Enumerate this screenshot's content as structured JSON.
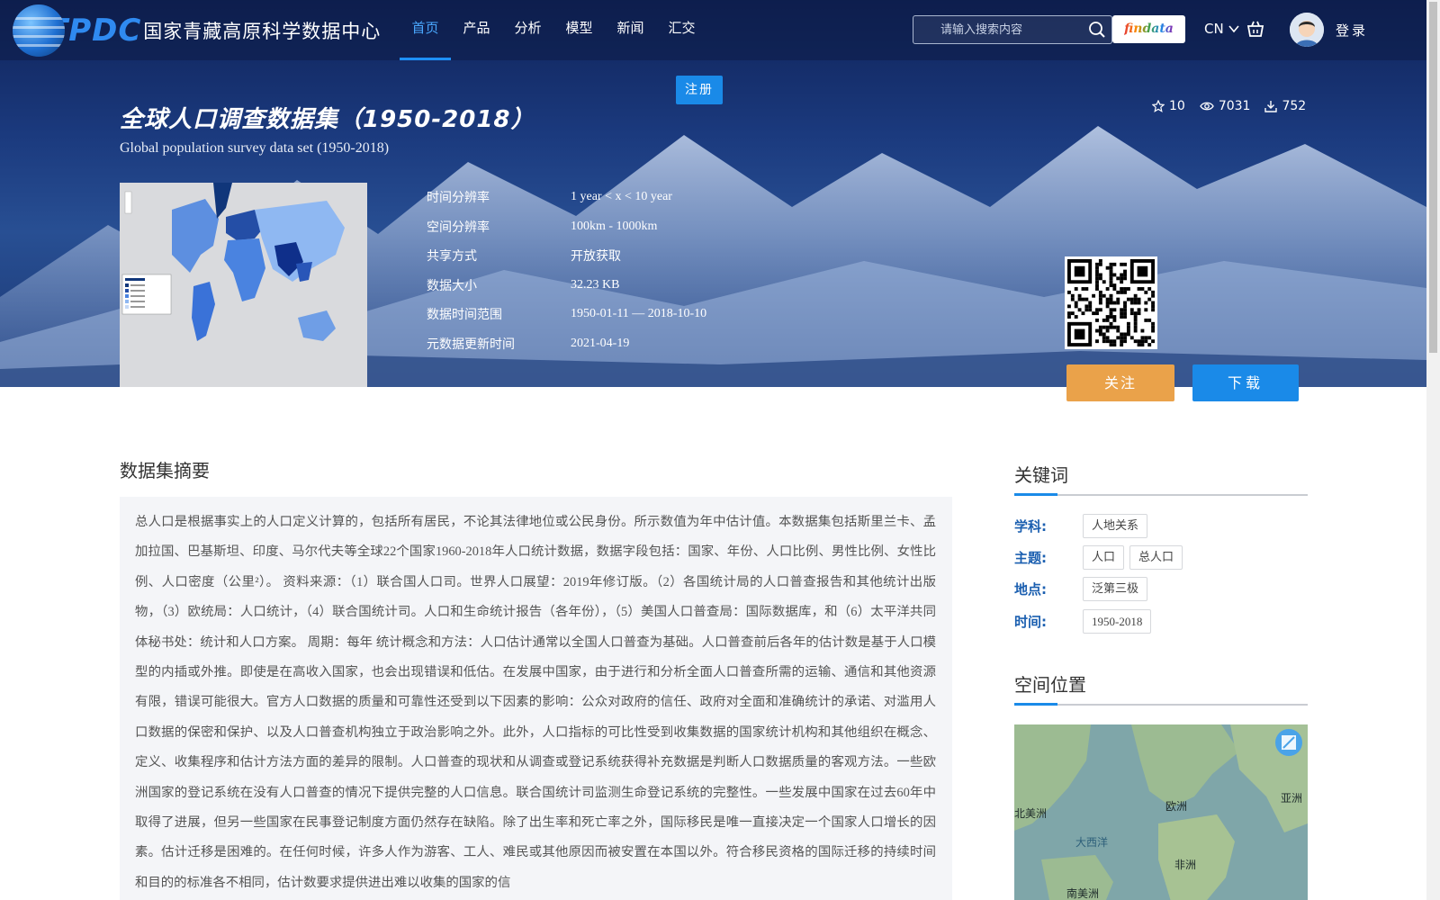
{
  "header": {
    "logo_mark": "TPDC",
    "logo_name": "国家青藏高原科学数据中心",
    "nav": [
      "首页",
      "产品",
      "分析",
      "模型",
      "新闻",
      "汇交"
    ],
    "active_nav": "首页",
    "search_placeholder": "请输入搜索内容",
    "findata_label": "findata",
    "lang": "CN",
    "login": "登录"
  },
  "register_label": "注册",
  "dataset": {
    "title_cn": "全球人口调查数据集（1950-2018）",
    "title_en": "Global population survey data set (1950-2018)",
    "stars": "10",
    "views": "7031",
    "downloads": "752",
    "meta": [
      {
        "key": "时间分辨率",
        "value": "1 year < x < 10 year"
      },
      {
        "key": "空间分辨率",
        "value": "100km - 1000km"
      },
      {
        "key": "共享方式",
        "value": "开放获取"
      },
      {
        "key": "数据大小",
        "value": "32.23 KB"
      },
      {
        "key": "数据时间范围",
        "value": "1950-01-11 — 2018-10-10"
      },
      {
        "key": "元数据更新时间",
        "value": "2021-04-19"
      }
    ],
    "follow_label": "关注",
    "download_label": "下载"
  },
  "abstract": {
    "title": "数据集摘要",
    "text": "总人口是根据事实上的人口定义计算的，包括所有居民，不论其法律地位或公民身份。所示数值为年中估计值。本数据集包括斯里兰卡、孟加拉国、巴基斯坦、印度、马尔代夫等全球22个国家1960-2018年人口统计数据，数据字段包括：国家、年份、人口比例、男性比例、女性比例、人口密度（公里²）。 资料来源：（1）联合国人口司。世界人口展望：2019年修订版。（2）各国统计局的人口普查报告和其他统计出版物，（3）欧统局：人口统计，（4）联合国统计司。人口和生命统计报告（各年份），（5）美国人口普查局：国际数据库，和（6）太平洋共同体秘书处：统计和人口方案。 周期：每年 统计概念和方法：人口估计通常以全国人口普查为基础。人口普查前后各年的估计数是基于人口模型的内插或外推。即使是在高收入国家，也会出现错误和低估。在发展中国家，由于进行和分析全面人口普查所需的运输、通信和其他资源有限，错误可能很大。官方人口数据的质量和可靠性还受到以下因素的影响：公众对政府的信任、政府对全面和准确统计的承诺、对滥用人口数据的保密和保护、以及人口普查机构独立于政治影响之外。此外，人口指标的可比性受到收集数据的国家统计机构和其他组织在概念、定义、收集程序和估计方法方面的差异的限制。人口普查的现状和从调查或登记系统获得补充数据是判断人口数据质量的客观方法。一些欧洲国家的登记系统在没有人口普查的情况下提供完整的人口信息。联合国统计司监测生命登记系统的完整性。一些发展中国家在过去60年中取得了进展，但另一些国家在民事登记制度方面仍然存在缺陷。除了出生率和死亡率之外，国际移民是唯一直接决定一个国家人口增长的因素。估计迁移是困难的。在任何时候，许多人作为游客、工人、难民或其他原因而被安置在本国以外。符合移民资格的国际迁移的持续时间和目的的标准各不相同，估计数要求提供进出难以收集的国家的信"
  },
  "keywords": {
    "title": "关键词",
    "rows": [
      {
        "label": "学科:",
        "tags": [
          "人地关系"
        ]
      },
      {
        "label": "主题:",
        "tags": [
          "人口",
          "总人口"
        ]
      },
      {
        "label": "地点:",
        "tags": [
          "泛第三极"
        ]
      },
      {
        "label": "时间:",
        "tags": [
          "1950-2018"
        ]
      }
    ]
  },
  "location": {
    "title": "空间位置",
    "labels": [
      "北美洲",
      "欧洲",
      "亚洲",
      "大西洋",
      "非洲",
      "南美洲"
    ]
  },
  "colors": {
    "accent": "#1a8ae8",
    "follow": "#eaa24a",
    "hero": "#1b3a7e"
  }
}
